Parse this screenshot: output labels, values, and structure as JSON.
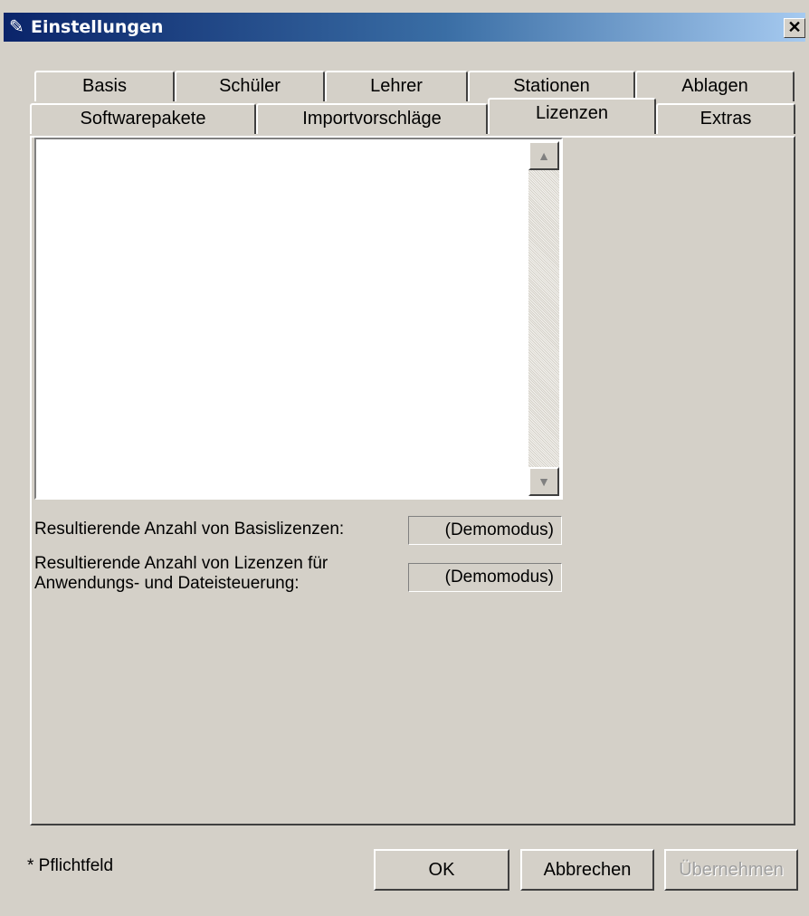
{
  "window": {
    "title": "Einstellungen",
    "close_glyph": "✕"
  },
  "icons": {
    "title_icon": "pen-icon",
    "close": "close-icon",
    "scroll_up": "arrow-up-icon",
    "scroll_down": "arrow-down-icon"
  },
  "tabs_row1": [
    {
      "label": "Basis"
    },
    {
      "label": "Schüler"
    },
    {
      "label": "Lehrer"
    },
    {
      "label": "Stationen"
    },
    {
      "label": "Ablagen"
    }
  ],
  "tabs_row2": [
    {
      "label": "Softwarepakete"
    },
    {
      "label": "Importvorschläge"
    },
    {
      "label": "Lizenzen",
      "active": true
    },
    {
      "label": "Extras"
    }
  ],
  "licenses": {
    "basis_label": "Resultierende Anzahl von Basislizenzen:",
    "basis_value": "(Demomodus)",
    "control_label_line1": "Resultierende Anzahl von Lizenzen für",
    "control_label_line2": "Anwendungs- und Dateisteuerung:",
    "control_value": "(Demomodus)"
  },
  "footer": {
    "required_note": "* Pflichtfeld",
    "ok_label": "OK",
    "cancel_label": "Abbrechen",
    "apply_label": "Übernehmen"
  },
  "colors": {
    "title_start": "#0a246a",
    "title_end": "#a6caf0",
    "face": "#d4d0c8"
  }
}
